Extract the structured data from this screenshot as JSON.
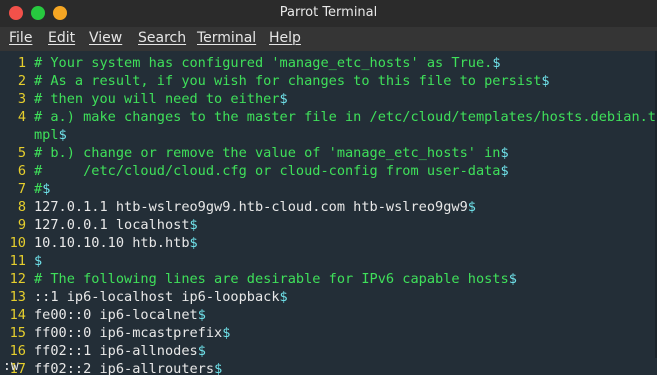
{
  "window": {
    "title": "Parrot Terminal",
    "buttons": {
      "close": "#f2514a",
      "minimize": "#27c93f",
      "maximize": "#f5a623"
    }
  },
  "menu": [
    "File",
    "Edit",
    "View",
    "Search",
    "Terminal",
    "Help"
  ],
  "colors": {
    "background": "#232e37",
    "line_number": "#e6cf2d",
    "comment": "#3fe05a",
    "text": "#e8e8e8",
    "end_of_line": "#6fe0e8"
  },
  "editor": {
    "lines": [
      {
        "num": "1",
        "text": "# Your system has configured 'manage_etc_hosts' as True.",
        "eol": "$",
        "type": "comment"
      },
      {
        "num": "2",
        "text": "# As a result, if you wish for changes to this file to persist",
        "eol": "$",
        "type": "comment"
      },
      {
        "num": "3",
        "text": "# then you will need to either",
        "eol": "$",
        "type": "comment"
      },
      {
        "num": "4",
        "text": "# a.) make changes to the master file in /etc/cloud/templates/hosts.debian.t",
        "eol": "",
        "type": "comment"
      },
      {
        "num": "",
        "text": "mpl",
        "eol": "$",
        "type": "comment"
      },
      {
        "num": "5",
        "text": "# b.) change or remove the value of 'manage_etc_hosts' in",
        "eol": "$",
        "type": "comment"
      },
      {
        "num": "6",
        "text": "#     /etc/cloud/cloud.cfg or cloud-config from user-data",
        "eol": "$",
        "type": "comment"
      },
      {
        "num": "7",
        "text": "#",
        "eol": "$",
        "type": "comment"
      },
      {
        "num": "8",
        "text": "127.0.1.1 htb-wslreo9gw9.htb-cloud.com htb-wslreo9gw9",
        "eol": "$",
        "type": "text"
      },
      {
        "num": "9",
        "text": "127.0.0.1 localhost",
        "eol": "$",
        "type": "text"
      },
      {
        "num": "10",
        "text": "10.10.10.10 htb.htb",
        "eol": "$",
        "type": "text"
      },
      {
        "num": "11",
        "text": "",
        "eol": "$",
        "type": "text"
      },
      {
        "num": "12",
        "text": "# The following lines are desirable for IPv6 capable hosts",
        "eol": "$",
        "type": "comment"
      },
      {
        "num": "13",
        "text": "::1 ip6-localhost ip6-loopback",
        "eol": "$",
        "type": "text"
      },
      {
        "num": "14",
        "text": "fe00::0 ip6-localnet",
        "eol": "$",
        "type": "text"
      },
      {
        "num": "15",
        "text": "ff00::0 ip6-mcastprefix",
        "eol": "$",
        "type": "text"
      },
      {
        "num": "16",
        "text": "ff02::1 ip6-allnodes",
        "eol": "$",
        "type": "text"
      },
      {
        "num": "17",
        "text": "ff02::2 ip6-allrouters",
        "eol": "$",
        "type": "text"
      }
    ]
  },
  "command_line": ":w"
}
